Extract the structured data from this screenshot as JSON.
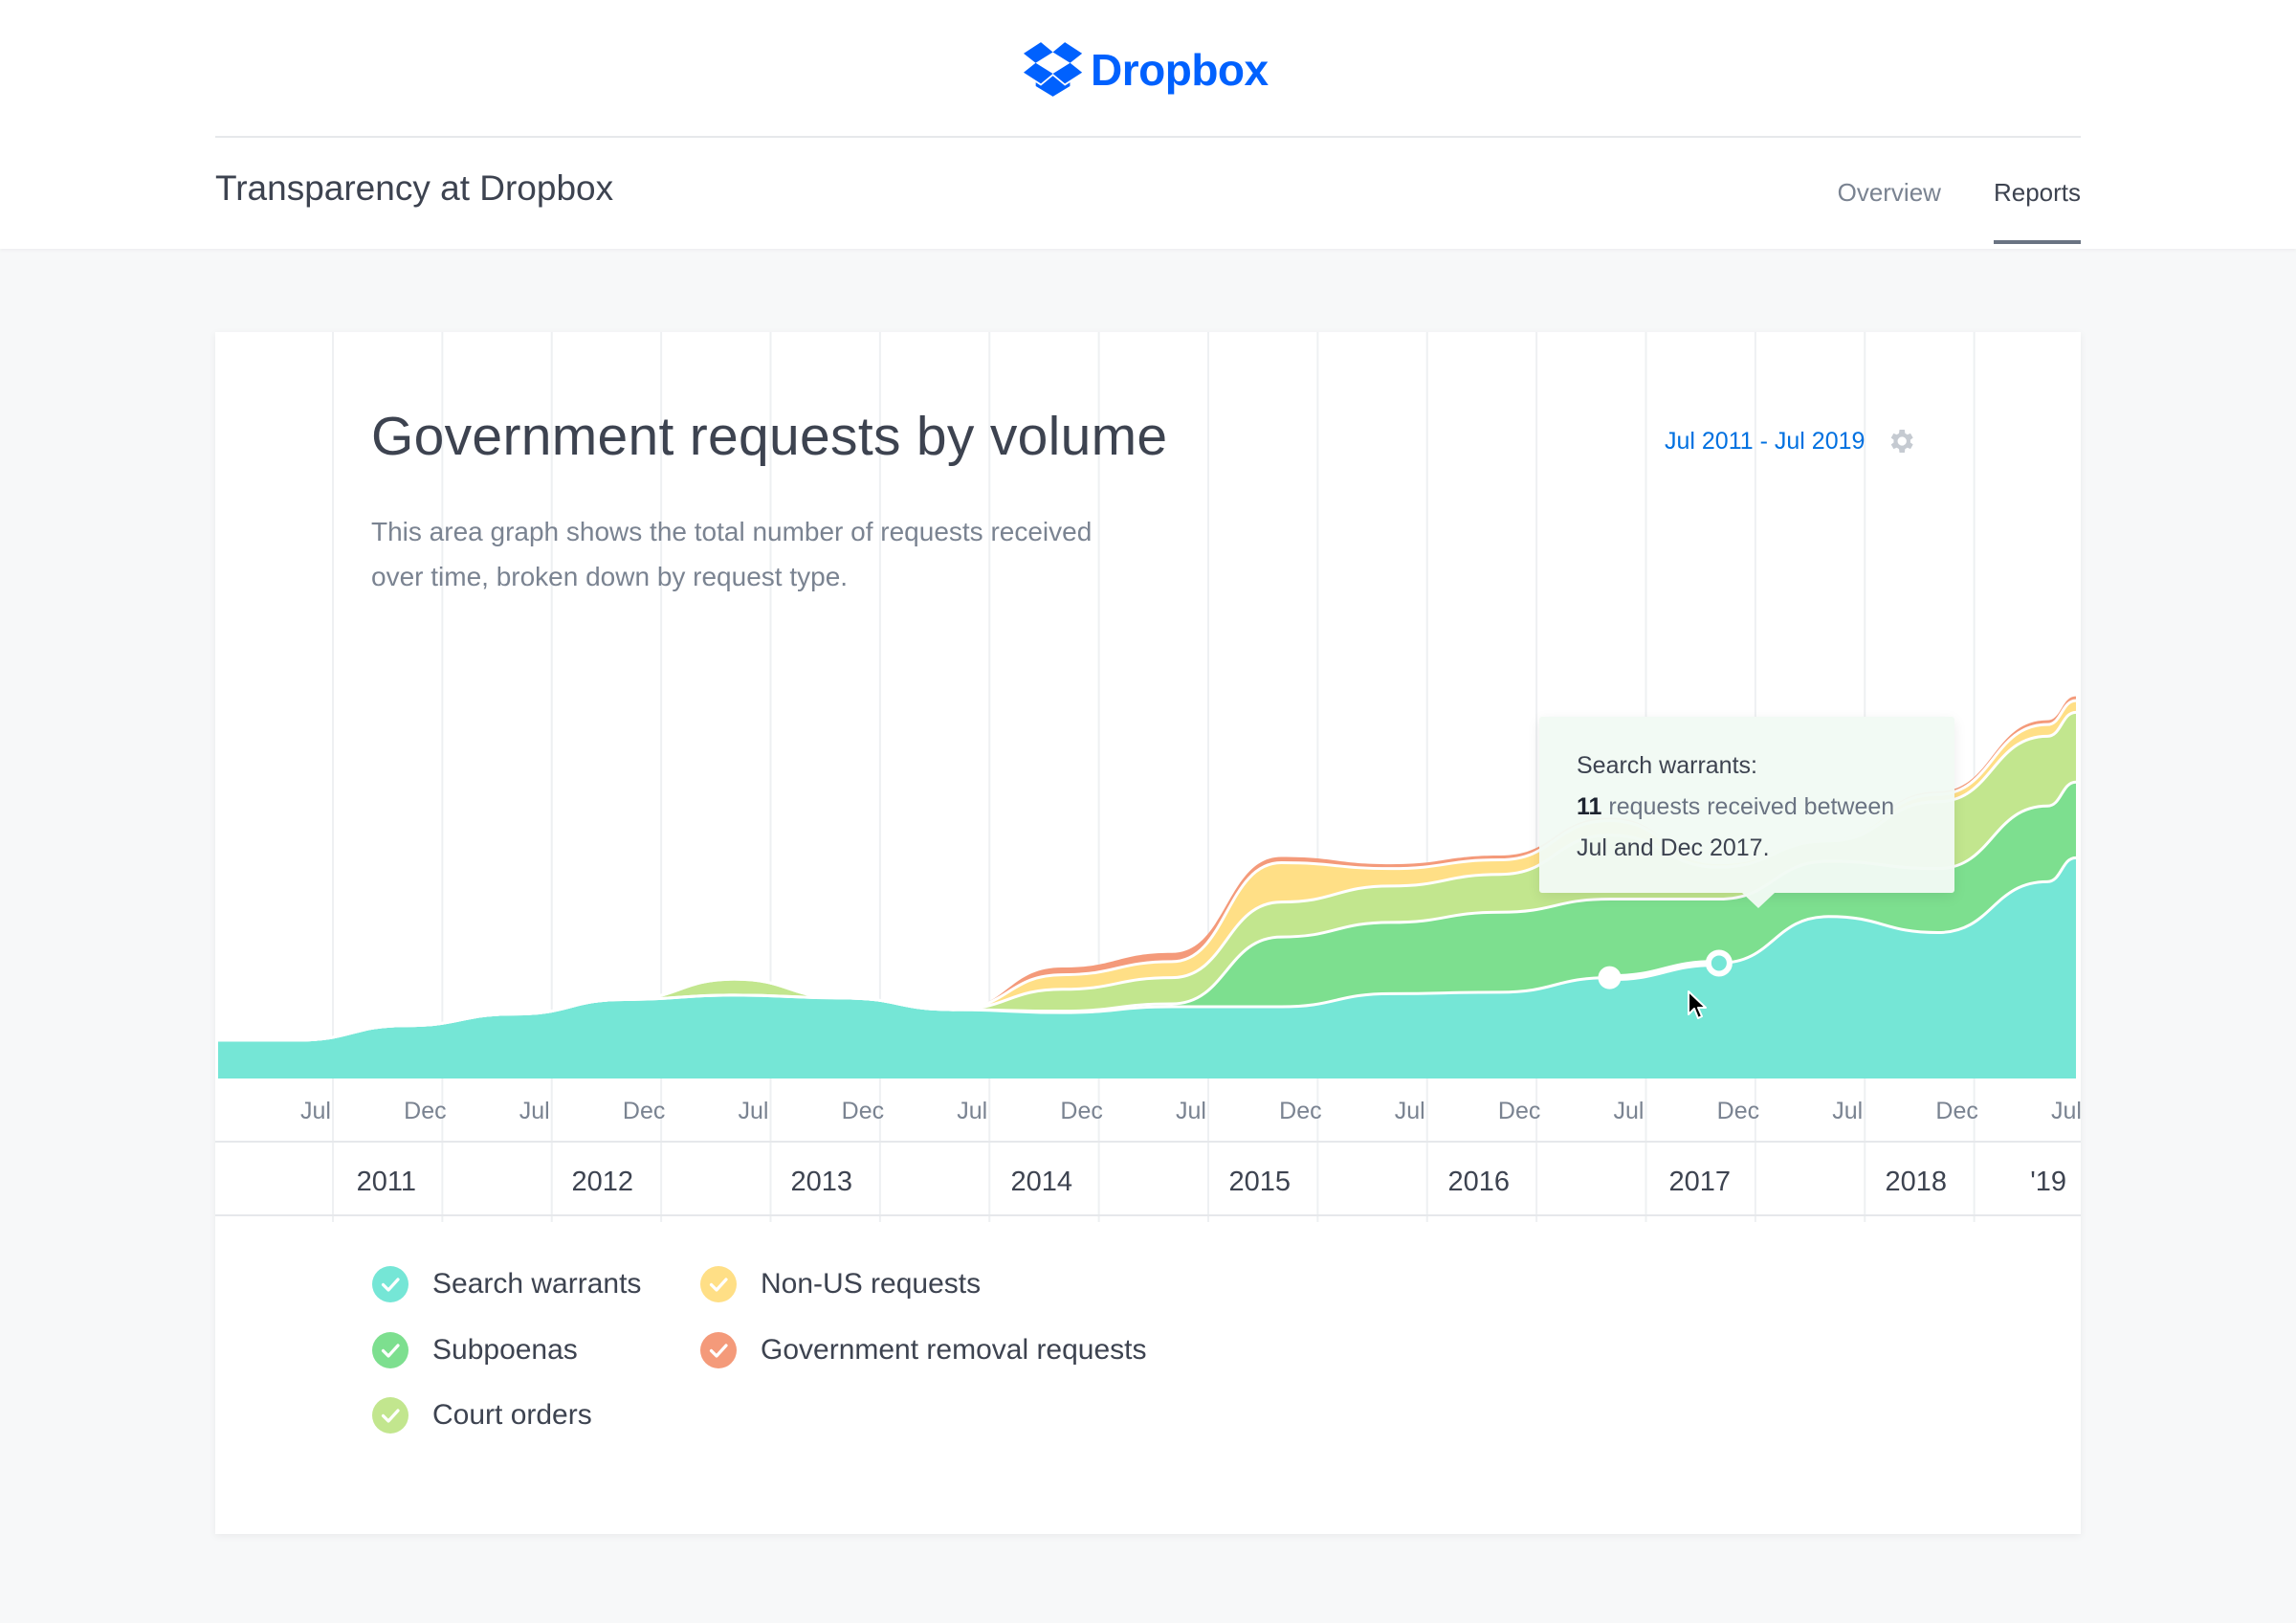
{
  "header": {
    "brand": "Dropbox",
    "site_title": "Transparency at Dropbox",
    "nav": [
      {
        "label": "Overview",
        "active": false
      },
      {
        "label": "Reports",
        "active": true
      }
    ]
  },
  "card": {
    "title": "Government requests by volume",
    "description": "This area graph shows the total number of requests received over time, broken down by request type.",
    "date_range": "Jul 2011 - Jul 2019",
    "settings_icon": "gear-icon"
  },
  "tooltip": {
    "heading": "Search warrants:",
    "count": "11",
    "text_mid": "requests received between",
    "text_end": "Jul and Dec 2017."
  },
  "colors": {
    "brand": "#0061fe",
    "accent_link": "#0070e0",
    "search_warrants": "#75e6d6",
    "subpoenas": "#7ddf8f",
    "court_orders": "#c2e68e",
    "non_us_requests": "#ffdf86",
    "government_removal_requests": "#f49a7a"
  },
  "legend": [
    {
      "label": "Search warrants",
      "color": "#75e6d6"
    },
    {
      "label": "Subpoenas",
      "color": "#7ddf8f"
    },
    {
      "label": "Court orders",
      "color": "#c2e68e"
    },
    {
      "label": "Non-US requests",
      "color": "#ffdf86"
    },
    {
      "label": "Government removal requests",
      "color": "#f49a7a"
    }
  ],
  "chart_data": {
    "type": "area",
    "stacked": true,
    "x": [
      "Jul 2011",
      "Dec 2011",
      "Jul 2012",
      "Dec 2012",
      "Jul 2013",
      "Dec 2013",
      "Jul 2014",
      "Dec 2014",
      "Jul 2015",
      "Dec 2015",
      "Jul 2016",
      "Dec 2016",
      "Jul 2017",
      "Dec 2017",
      "Jul 2018",
      "Dec 2018",
      "Jul 2019"
    ],
    "tick_labels": [
      "Jul",
      "Dec",
      "Jul",
      "Dec",
      "Jul",
      "Dec",
      "Jul",
      "Dec",
      "Jul",
      "Dec",
      "Jul",
      "Dec",
      "Jul",
      "Dec",
      "Jul",
      "Dec",
      "Jul"
    ],
    "year_labels": [
      "2011",
      "2012",
      "2013",
      "2014",
      "2015",
      "2016",
      "2017",
      "2018",
      "'19"
    ],
    "series": [
      {
        "name": "Search warrants",
        "color": "#75e6d6",
        "values": [
          2.5,
          3.5,
          4.3,
          5.3,
          5.6,
          5.4,
          4.6,
          4.4,
          4.8,
          4.8,
          5.7,
          5.8,
          6.8,
          7.8,
          11.0,
          9.9,
          13.4
        ]
      },
      {
        "name": "Subpoenas",
        "color": "#7ddf8f",
        "values": [
          0,
          0,
          0,
          0,
          0,
          0,
          0,
          0.1,
          0.2,
          4.8,
          4.9,
          5.5,
          5.4,
          4.4,
          3.8,
          4.4,
          5.2
        ]
      },
      {
        "name": "Court orders",
        "color": "#c2e68e",
        "values": [
          0,
          0,
          0,
          0,
          1.1,
          0,
          0,
          1.5,
          1.8,
          2.4,
          2.5,
          2.6,
          4.4,
          2.2,
          1.4,
          4.6,
          4.8
        ]
      },
      {
        "name": "Non-US requests",
        "color": "#ffdf86",
        "values": [
          0,
          0,
          0,
          0,
          0,
          0,
          0,
          1.0,
          1.1,
          2.7,
          1.2,
          1.0,
          1.0,
          0.3,
          0.2,
          0.5,
          0.8
        ]
      },
      {
        "name": "Government removal requests",
        "color": "#f49a7a",
        "values": [
          0,
          0,
          0,
          0,
          0,
          0,
          0,
          0.5,
          0.6,
          0.4,
          0.3,
          0.3,
          0.2,
          0.1,
          0.1,
          0.2,
          0.3
        ]
      }
    ],
    "title": "Government requests by volume",
    "highlighted_point": {
      "series": "Search warrants",
      "period": "Jul - Dec 2017",
      "value": 11
    },
    "grid": "vertical",
    "legend": "bottom-left"
  }
}
